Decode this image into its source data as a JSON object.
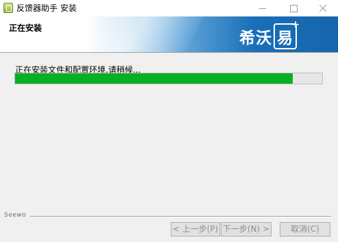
{
  "window": {
    "title": "反馈器助手 安装",
    "minimize_icon": "minimize-icon",
    "maximize_icon": "maximize-icon",
    "close_icon": "close-icon"
  },
  "header": {
    "title": "正在安装",
    "brand_text": "希沃",
    "brand_box_text": "易",
    "brand_plus": "+"
  },
  "main": {
    "status": "正在安装文件和配置环境,请稍候...",
    "progress": 0.905,
    "progress_color": "#06b025"
  },
  "footer": {
    "brand": "Seewo",
    "back_label": "< 上一步(P)",
    "next_label": "下一步(N) >",
    "cancel_label": "取消(C)"
  }
}
